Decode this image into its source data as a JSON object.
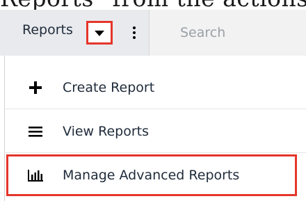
{
  "caption": {
    "fragment": "Reports\" from the actions m"
  },
  "header": {
    "module_label": "Reports",
    "search": {
      "placeholder": "Search",
      "value": ""
    }
  },
  "menu": {
    "items": [
      {
        "label": "Create Report",
        "icon": "plus-icon"
      },
      {
        "label": "View Reports",
        "icon": "list-icon"
      },
      {
        "label": "Manage Advanced Reports",
        "icon": "bar-chart-icon"
      }
    ]
  },
  "colors": {
    "highlight": "#e5352b",
    "text": "#1f2b3a",
    "nav_bg": "#f2f2f2"
  }
}
